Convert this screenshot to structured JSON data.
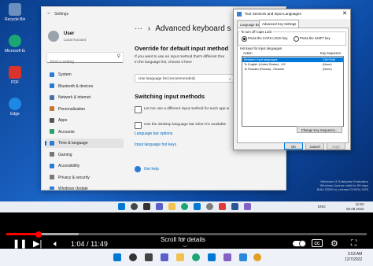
{
  "desktop": {
    "icons": [
      {
        "label": "Recycle Bin",
        "color": "#6d8fbf"
      },
      {
        "label": "Microsoft Edge",
        "color": "#1ba672"
      },
      {
        "label": "PDF",
        "color": "#d9332b"
      },
      {
        "label": "Edge",
        "color": "#1e88e5"
      }
    ]
  },
  "settings": {
    "window_title": "Settings",
    "user": {
      "name": "User",
      "account": "Local Account"
    },
    "search_placeholder": "Find a setting",
    "nav": [
      {
        "label": "System",
        "color": "#2b7bd6"
      },
      {
        "label": "Bluetooth & devices",
        "color": "#2b7bd6"
      },
      {
        "label": "Network & internet",
        "color": "#4a6fa5"
      },
      {
        "label": "Personalization",
        "color": "#c0772e"
      },
      {
        "label": "Apps",
        "color": "#555"
      },
      {
        "label": "Accounts",
        "color": "#2f9e6e"
      },
      {
        "label": "Time & language",
        "color": "#2b7bd6"
      },
      {
        "label": "Gaming",
        "color": "#777"
      },
      {
        "label": "Accessibility",
        "color": "#2b7bd6"
      },
      {
        "label": "Privacy & security",
        "color": "#777"
      },
      {
        "label": "Windows Update",
        "color": "#2b7bd6"
      }
    ],
    "active_nav": "Time & language",
    "breadcrumb_sep": "›",
    "page_title": "Advanced keyboard s",
    "override_heading": "Override for default input method",
    "override_desc_1": "If you want to use an input method that’s different thar",
    "override_desc_2": "in the language list, choose it here",
    "override_select": "Use language list (recommended)",
    "switching_heading": "Switching input methods",
    "switch_option_1": "Let me use a different input method for each app w",
    "switch_option_2": "Use the desktop language bar when it’s available",
    "link_language_bar": "Language bar options",
    "link_hotkeys": "Input language hot keys",
    "link_help": "Get help"
  },
  "dialog": {
    "title": "Text Services and Input Languages",
    "close": "✕",
    "tabs": [
      "Language Bar",
      "Advanced Key Settings"
    ],
    "active_tab": "Advanced Key Settings",
    "caps_group_label": "To turn off Caps Lock",
    "caps_option_1": "Press the CAPS LOCK key",
    "caps_option_2": "Press the SHIFT key",
    "hotkeys_group_label": "Hot keys for input languages",
    "col_action": "Action",
    "col_key": "Key sequence",
    "rows": [
      {
        "action": "Between input languages",
        "key": "Ctrl+Shift",
        "selected": true
      },
      {
        "action": "To English (United States) - US",
        "key": "(None)",
        "selected": false
      },
      {
        "action": "To Russian (Russia) - Russian",
        "key": "(None)",
        "selected": false
      }
    ],
    "change_key_btn": "Change Key Sequence...",
    "ok_btn": "OK",
    "cancel_btn": "Cancel",
    "apply_btn": "Apply"
  },
  "vm": {
    "watermark_line_1": "Windows 11 Enterprise Evaluation",
    "watermark_line_2": "Windows License valid for 89 days",
    "watermark_line_3": "Build 22000.ni_release.210604-1628",
    "tray_lang": "ENG",
    "tray_time": "11:52",
    "tray_date": "06.08.2022"
  },
  "player": {
    "time_current": "1:04",
    "time_total": "11:49",
    "scroll_hint": "Scroll for details",
    "progress": 0.09,
    "buffered": 0.2
  },
  "host": {
    "time": "3:53 AM",
    "date": "12/7/2022"
  }
}
